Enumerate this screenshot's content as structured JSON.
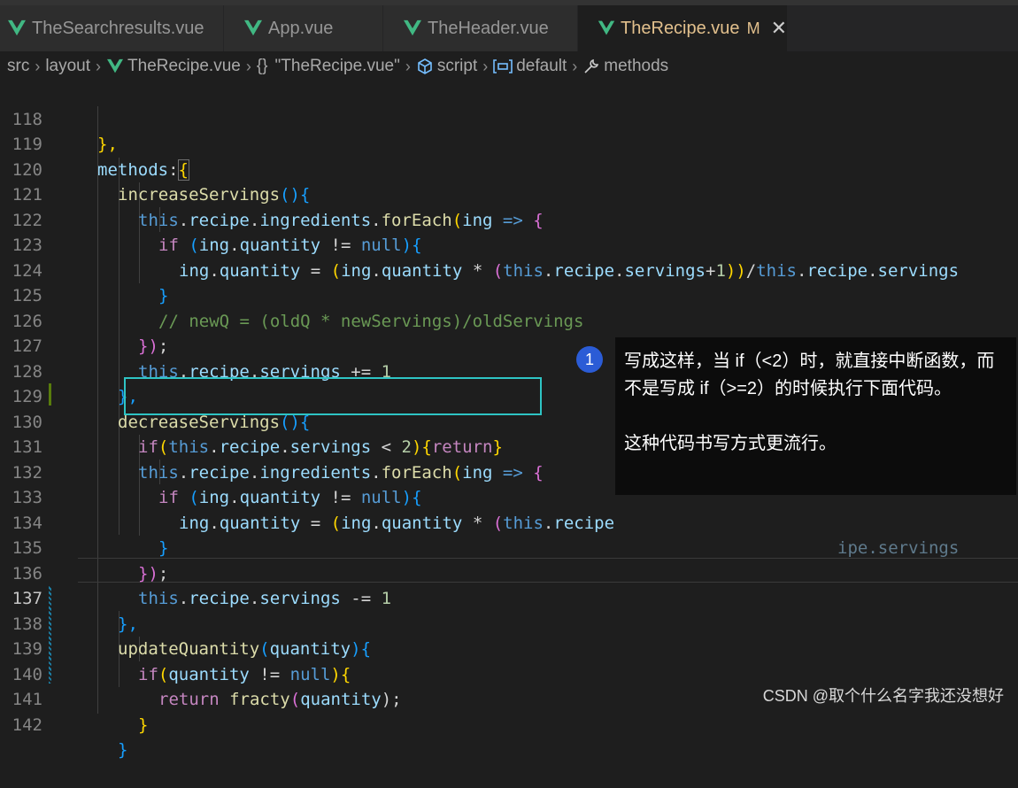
{
  "tabs": [
    {
      "label": "TheSearchresults.vue"
    },
    {
      "label": "App.vue"
    },
    {
      "label": "TheHeader.vue"
    },
    {
      "label": "TheRecipe.vue",
      "modified": "M",
      "close": "✕"
    }
  ],
  "breadcrumb": {
    "items": [
      "src",
      "layout",
      "TheRecipe.vue",
      "\"TheRecipe.vue\"",
      "script",
      "default",
      "methods"
    ],
    "braces": "{}"
  },
  "lines": [
    {
      "num": "118"
    },
    {
      "num": "119"
    },
    {
      "num": "120"
    },
    {
      "num": "121"
    },
    {
      "num": "122"
    },
    {
      "num": "123"
    },
    {
      "num": "124"
    },
    {
      "num": "125"
    },
    {
      "num": "126"
    },
    {
      "num": "127"
    },
    {
      "num": "128"
    },
    {
      "num": "129"
    },
    {
      "num": "130"
    },
    {
      "num": "131"
    },
    {
      "num": "132"
    },
    {
      "num": "133"
    },
    {
      "num": "134"
    },
    {
      "num": "135"
    },
    {
      "num": "136"
    },
    {
      "num": "137"
    },
    {
      "num": "138"
    },
    {
      "num": "139"
    },
    {
      "num": "140"
    },
    {
      "num": "141"
    },
    {
      "num": "142"
    }
  ],
  "code": {
    "l118": [
      "},"
    ],
    "l119": [
      "methods",
      ":",
      "{"
    ],
    "l120": [
      "increaseServings",
      "()",
      "{"
    ],
    "l121": [
      "this",
      ".",
      "recipe",
      ".",
      "ingredients",
      ".",
      "forEach",
      "(",
      "ing",
      " => ",
      "{"
    ],
    "l122": [
      "if",
      " (",
      "ing",
      ".",
      "quantity",
      " != ",
      "null",
      ")",
      "{"
    ],
    "l123": [
      "ing",
      ".",
      "quantity",
      " = ",
      "(",
      "ing",
      ".",
      "quantity",
      " * ",
      "(",
      "this",
      ".",
      "recipe",
      ".",
      "servings",
      "+",
      "1",
      "))",
      "/",
      "this",
      ".",
      "recipe",
      ".",
      "servings"
    ],
    "l124": [
      "}"
    ],
    "l125": [
      "// newQ = (oldQ * newServings)/oldServings"
    ],
    "l126": [
      "})",
      ";"
    ],
    "l127": [
      "this",
      ".",
      "recipe",
      ".",
      "servings",
      " += ",
      "1"
    ],
    "l128": [
      "},"
    ],
    "l129": [
      "decreaseServings",
      "()",
      "{"
    ],
    "l130": [
      "if",
      "(",
      "this",
      ".",
      "recipe",
      ".",
      "servings",
      " < ",
      "2",
      ")",
      "{",
      "return",
      "}"
    ],
    "l131": [
      "this",
      ".",
      "recipe",
      ".",
      "ingredients",
      ".",
      "forEach",
      "(",
      "ing",
      " => ",
      "{"
    ],
    "l132": [
      "if",
      " (",
      "ing",
      ".",
      "quantity",
      " != ",
      "null",
      ")",
      "{"
    ],
    "l133": [
      "ing",
      ".",
      "quantity",
      " = ",
      "(",
      "ing",
      ".",
      "quantity",
      " * ",
      "(",
      "this",
      ".",
      "recipe",
      "ipe.servings"
    ],
    "l134": [
      "}"
    ],
    "l135": [
      "})",
      ";"
    ],
    "l136": [
      "this",
      ".",
      "recipe",
      ".",
      "servings",
      " -= ",
      "1"
    ],
    "l137": [
      "},"
    ],
    "l138": [
      "updateQuantity",
      "(",
      "quantity",
      ")",
      "{"
    ],
    "l139": [
      "if",
      "(",
      "quantity",
      " != ",
      "null",
      ")",
      "{"
    ],
    "l140": [
      "return",
      " ",
      "fracty",
      "(",
      "quantity",
      ");"
    ],
    "l141": [
      "}"
    ],
    "l142": [
      "}"
    ]
  },
  "annotation": {
    "badge": "1",
    "para1": "写成这样，当 if（<2）时，就直接中断函数，而不是写成 if（>=2）的时候执行下面代码。",
    "para2": "这种代码书写方式更流行。"
  },
  "watermark": "CSDN @取个什么名字我还没想好",
  "colors": {
    "keyword": "#c586c0",
    "this": "#569cd6",
    "property": "#9cdcfe",
    "function": "#dcdcaa",
    "number": "#b5cea8",
    "comment": "#6a9955",
    "highlight_box": "#2ec4c4",
    "badge": "#2b5cd6",
    "active_tab_text": "#e2c08d",
    "vue_icon": "#41b883"
  }
}
